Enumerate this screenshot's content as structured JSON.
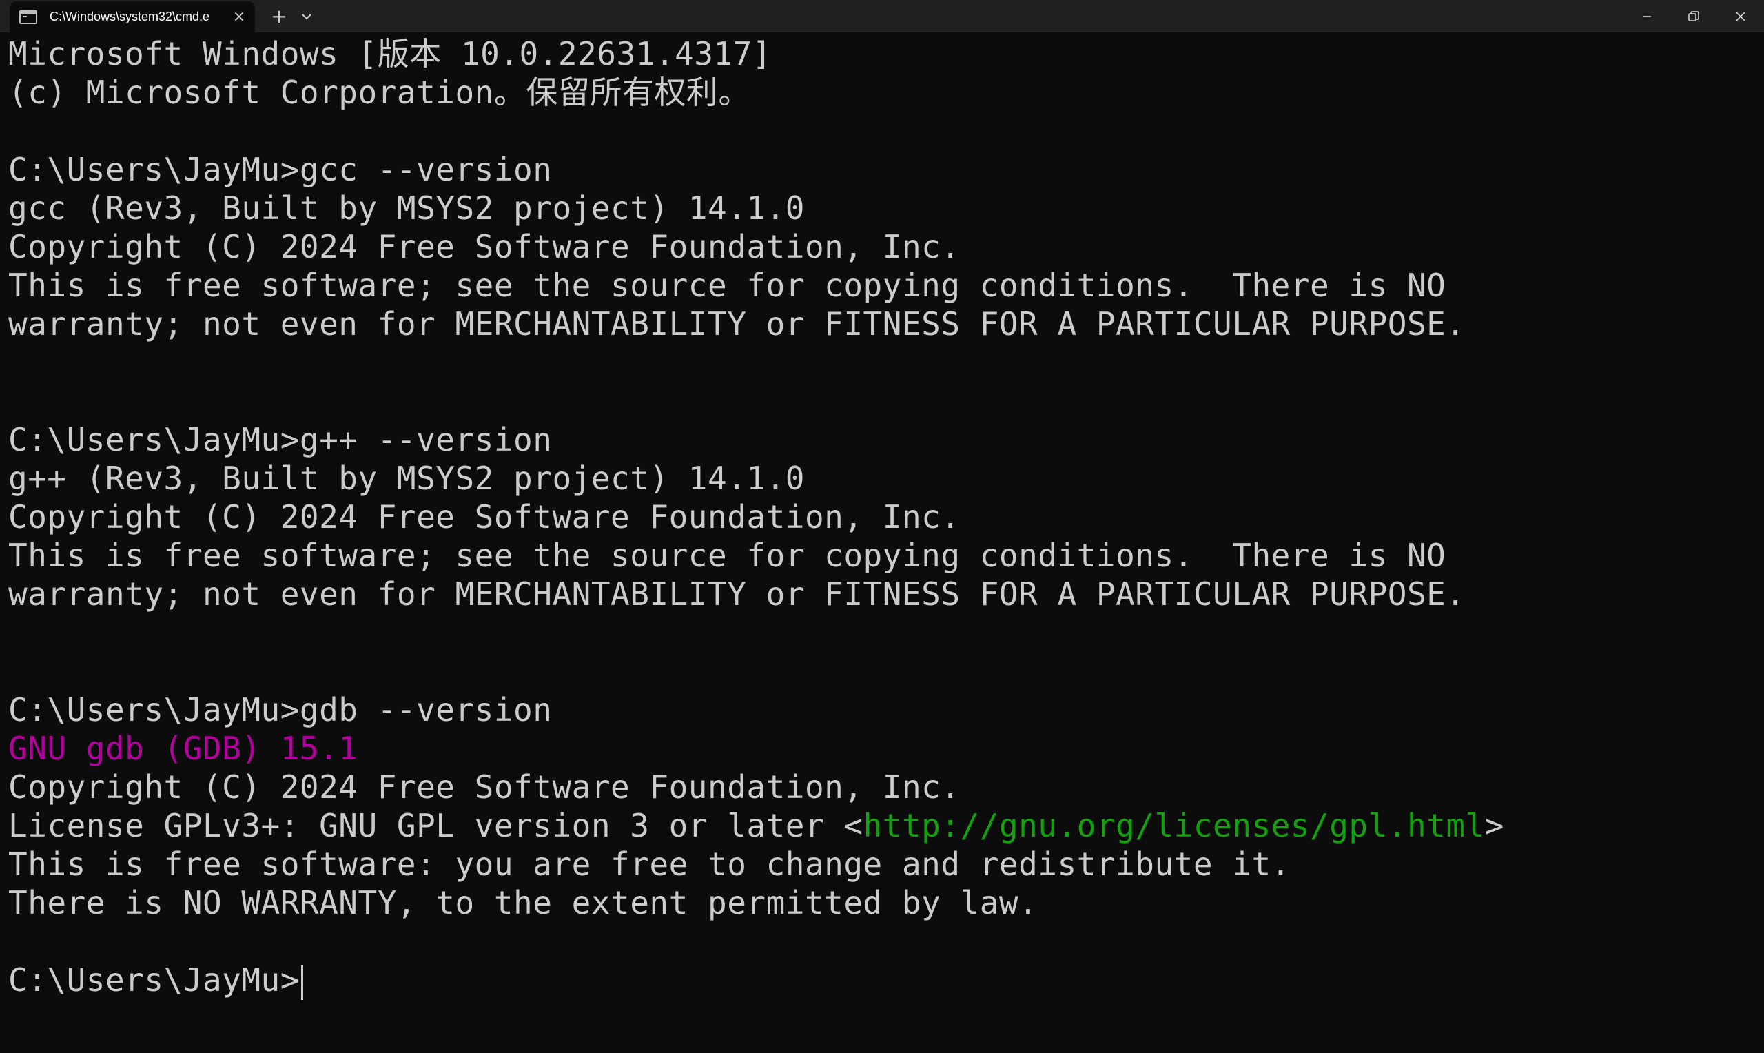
{
  "window": {
    "tab_title": "C:\\Windows\\system32\\cmd.e",
    "colors": {
      "titlebar": "#202020",
      "terminal_bg": "#0c0c0c",
      "text": "#cccccc",
      "magenta": "#b4009e",
      "link_green": "#13a10e"
    },
    "icons": [
      "cmd-icon",
      "close-icon",
      "plus-icon",
      "chevron-down-icon",
      "minimize-icon",
      "restore-icon",
      "close-window-icon"
    ]
  },
  "terminal": {
    "header": [
      "Microsoft Windows [版本 10.0.22631.4317]",
      "(c) Microsoft Corporation。保留所有权利。"
    ],
    "gcc": {
      "prompt": "C:\\Users\\JayMu>gcc --version",
      "output": [
        "gcc (Rev3, Built by MSYS2 project) 14.1.0",
        "Copyright (C) 2024 Free Software Foundation, Inc.",
        "This is free software; see the source for copying conditions.  There is NO",
        "warranty; not even for MERCHANTABILITY or FITNESS FOR A PARTICULAR PURPOSE."
      ]
    },
    "gpp": {
      "prompt": "C:\\Users\\JayMu>g++ --version",
      "output": [
        "g++ (Rev3, Built by MSYS2 project) 14.1.0",
        "Copyright (C) 2024 Free Software Foundation, Inc.",
        "This is free software; see the source for copying conditions.  There is NO",
        "warranty; not even for MERCHANTABILITY or FITNESS FOR A PARTICULAR PURPOSE."
      ]
    },
    "gdb": {
      "prompt": "C:\\Users\\JayMu>gdb --version",
      "version_line": "GNU gdb (GDB) 15.1",
      "copyright": "Copyright (C) 2024 Free Software Foundation, Inc.",
      "license_prefix": "License GPLv3+: GNU GPL version 3 or later <",
      "license_url": "http://gnu.org/licenses/gpl.html",
      "license_suffix": ">",
      "free_line": "This is free software: you are free to change and redistribute it.",
      "warranty_line": "There is NO WARRANTY, to the extent permitted by law."
    },
    "final_prompt": "C:\\Users\\JayMu>"
  }
}
